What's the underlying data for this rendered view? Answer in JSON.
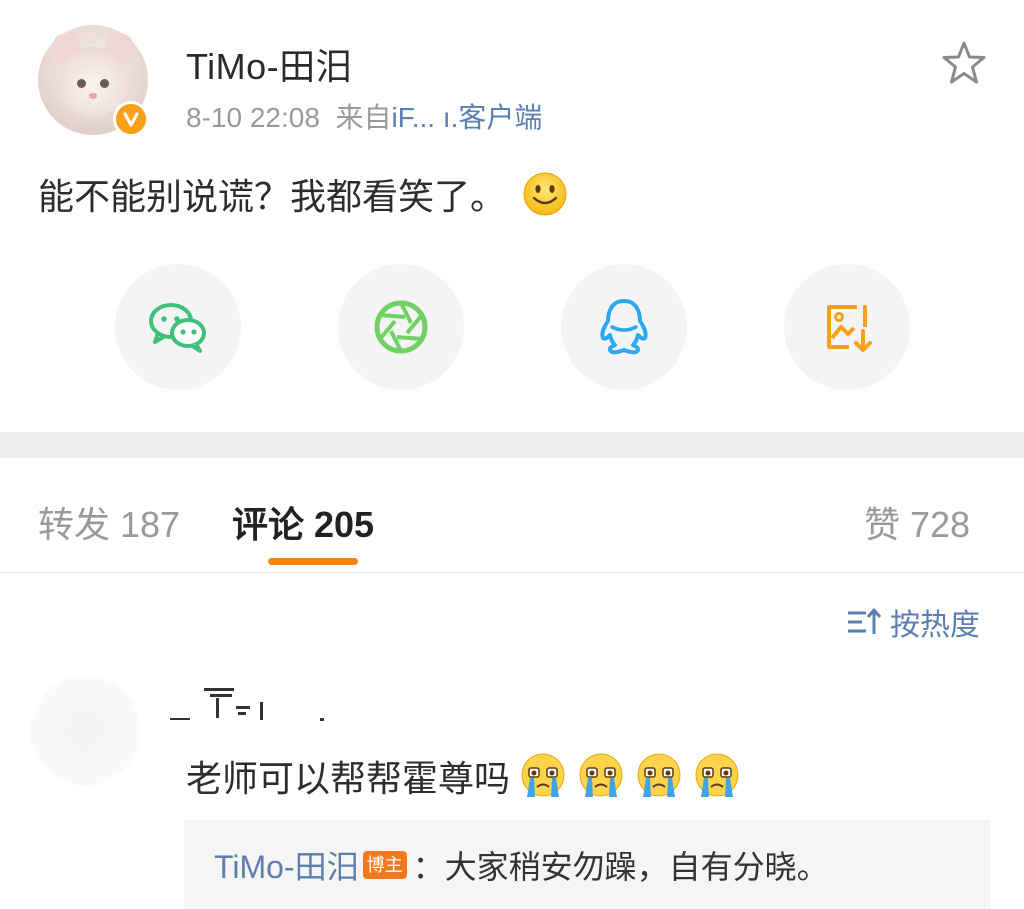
{
  "post": {
    "username": "TiMo-田汨",
    "time": "8-10 22:08",
    "source_prefix": "来自",
    "source_name": "iF...  ı.客户端",
    "content": "能不能别说谎？我都看笑了。",
    "icons": {
      "star": "star-outline-icon",
      "verified": "verified-v-badge-icon",
      "emoji": "smile-emoji-icon"
    }
  },
  "share": {
    "items": [
      {
        "name": "wechat",
        "icon": "wechat-icon",
        "color": "#3fc07b"
      },
      {
        "name": "moments",
        "icon": "moments-aperture-icon",
        "color": "#6fd063"
      },
      {
        "name": "qq",
        "icon": "qq-penguin-icon",
        "color": "#2aa9f2"
      },
      {
        "name": "save-image",
        "icon": "image-download-icon",
        "color": "#f7a11a"
      }
    ]
  },
  "tabs": {
    "repost": "转发 187",
    "comments": "评论 205",
    "likes": "赞 728",
    "active": "comments",
    "accent": "#f7820d"
  },
  "sort": {
    "label": "按热度",
    "icon": "sort-hot-icon"
  },
  "comment": {
    "text": "老师可以帮帮霍尊吗",
    "emoji_count": 4,
    "emoji_icon": "crying-emoji-icon",
    "reply": {
      "author": "TiMo-田汨",
      "badge": "博主",
      "separator": "：",
      "text": "大家稍安勿躁，自有分晓。"
    }
  },
  "colors": {
    "link_blue": "#5b7fb0",
    "meta_gray": "#9a9a9a",
    "text_dark": "#2d2d2d",
    "divider": "#eeeeee"
  }
}
